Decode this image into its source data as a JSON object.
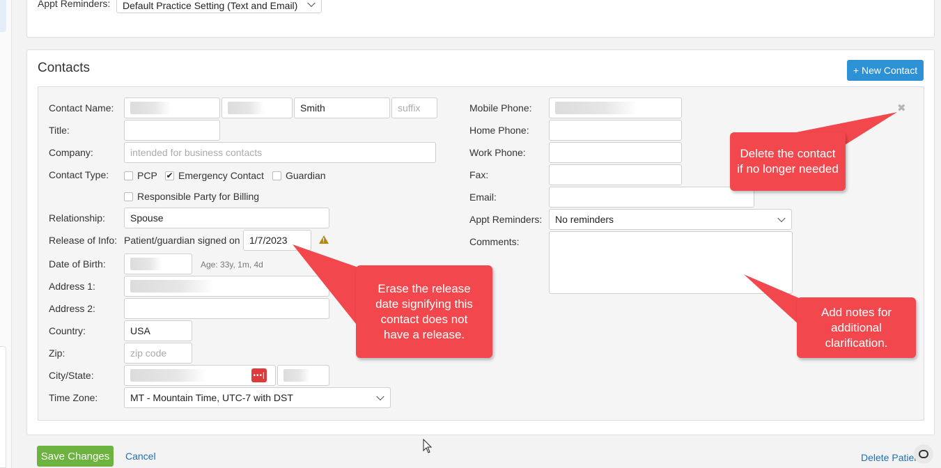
{
  "top": {
    "appt_reminders_label": "Appt Reminders:",
    "appt_reminders_value": "Default Practice Setting (Text and Email)"
  },
  "contacts": {
    "title": "Contacts",
    "new_contact_button": "+ New Contact"
  },
  "form_left": {
    "contact_name_label": "Contact Name:",
    "last_name": "Smith",
    "suffix_placeholder": "suffix",
    "title_label": "Title:",
    "company_label": "Company:",
    "company_placeholder": "intended for business contacts",
    "contact_type_label": "Contact Type:",
    "types": {
      "pcp": "PCP",
      "emergency": "Emergency Contact",
      "guardian": "Guardian",
      "responsible": "Responsible Party for Billing"
    },
    "relationship_label": "Relationship:",
    "relationship_value": "Spouse",
    "release_label": "Release of Info:",
    "release_text": "Patient/guardian signed on",
    "release_date": "1/7/2023",
    "dob_label": "Date of Birth:",
    "age_text": "Age: 33y, 1m, 4d",
    "address1_label": "Address 1:",
    "address2_label": "Address 2:",
    "country_label": "Country:",
    "country_value": "USA",
    "zip_label": "Zip:",
    "zip_placeholder": "zip code",
    "citystate_label": "City/State:",
    "timezone_label": "Time Zone:",
    "timezone_value": "MT - Mountain Time, UTC-7 with DST"
  },
  "form_right": {
    "mobile_label": "Mobile Phone:",
    "home_label": "Home Phone:",
    "work_label": "Work Phone:",
    "fax_label": "Fax:",
    "email_label": "Email:",
    "appt_label": "Appt Reminders:",
    "appt_value": "No reminders",
    "comments_label": "Comments:"
  },
  "callouts": {
    "delete": "Delete the contact if no longer needed",
    "release": "Erase the release date signifying this contact does not have a release.",
    "notes": "Add notes for additional clarification."
  },
  "footer": {
    "save": "Save Changes",
    "cancel": "Cancel",
    "delete_patient": "Delete Patient"
  },
  "colors": {
    "primary": "#2d91d6",
    "save": "#6cb33f",
    "callout": "#f2474c",
    "warning": "#b8860b"
  }
}
